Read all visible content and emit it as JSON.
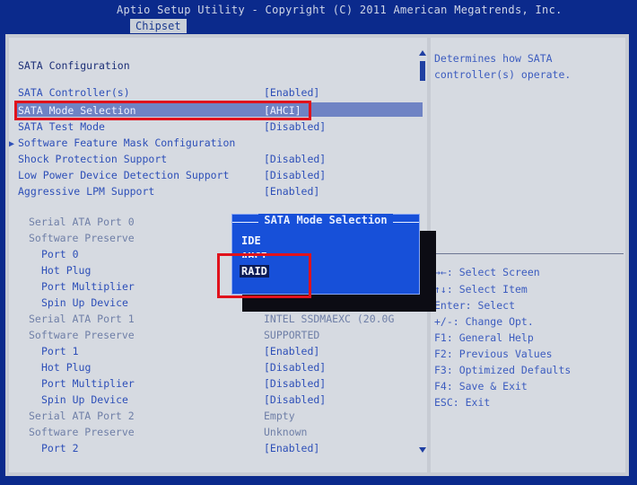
{
  "header": {
    "title": "Aptio Setup Utility - Copyright (C) 2011 American Megatrends, Inc.",
    "active_tab": "Chipset"
  },
  "main": {
    "section_title": "SATA Configuration",
    "items": [
      {
        "label": "SATA Controller(s)",
        "value": "[Enabled]"
      },
      {
        "label": "SATA Mode Selection",
        "value": "[AHCI]"
      },
      {
        "label": "SATA Test Mode",
        "value": "[Disabled]"
      },
      {
        "label": "Software Feature Mask Configuration",
        "value": ""
      },
      {
        "label": "Shock Protection Support",
        "value": "[Disabled]"
      },
      {
        "label": "Low Power Device Detection Support",
        "value": "[Disabled]"
      },
      {
        "label": "Aggressive LPM Support",
        "value": "[Enabled]"
      },
      {
        "label": "Serial ATA Port 0",
        "value": ""
      },
      {
        "label": "Software Preserve",
        "value": ""
      },
      {
        "label": "Port 0",
        "value": ""
      },
      {
        "label": "Hot Plug",
        "value": ""
      },
      {
        "label": "Port Multiplier",
        "value": ""
      },
      {
        "label": "Spin Up Device",
        "value": ""
      },
      {
        "label": "Serial ATA Port 1",
        "value": "INTEL SSDMAEXC (20.0G"
      },
      {
        "label": "Software Preserve",
        "value": "SUPPORTED"
      },
      {
        "label": "Port 1",
        "value": "[Enabled]"
      },
      {
        "label": "Hot Plug",
        "value": "[Disabled]"
      },
      {
        "label": "Port Multiplier",
        "value": "[Disabled]"
      },
      {
        "label": "Spin Up Device",
        "value": "[Disabled]"
      },
      {
        "label": "Serial ATA Port 2",
        "value": "Empty"
      },
      {
        "label": "Software Preserve",
        "value": "Unknown"
      },
      {
        "label": "Port 2",
        "value": "[Enabled]"
      }
    ]
  },
  "popup": {
    "title": "SATA Mode Selection",
    "options": [
      "IDE",
      "AHCI",
      "RAID"
    ],
    "selected": "RAID"
  },
  "help": {
    "description": [
      "Determines how SATA",
      "controller(s) operate."
    ],
    "keys": [
      "→←: Select Screen",
      "↑↓: Select Item",
      "Enter: Select",
      "+/-: Change Opt.",
      "F1: General Help",
      "F2: Previous Values",
      "F3: Optimized Defaults",
      "F4: Save & Exit",
      "ESC: Exit"
    ]
  },
  "colors": {
    "bios_blue": "#0b2a8c",
    "panel_gray": "#d6dae1",
    "popup_blue": "#1750d9",
    "annotation_red": "#e0121c"
  }
}
